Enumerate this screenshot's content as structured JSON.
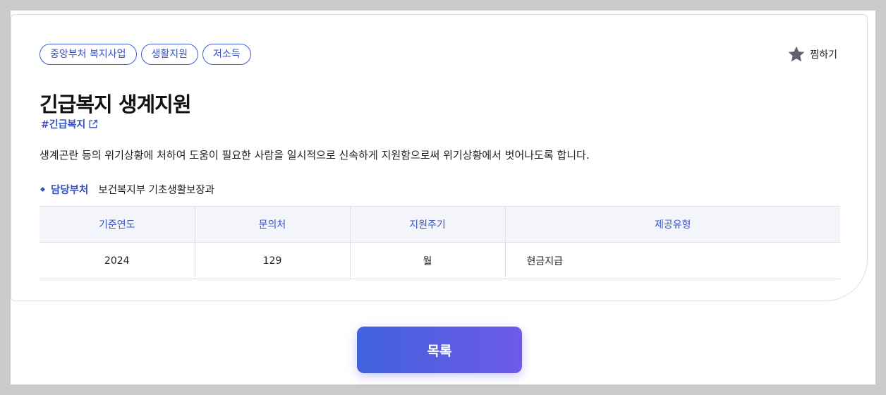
{
  "tags": [
    "중앙부처 복지사업",
    "생활지원",
    "저소득"
  ],
  "favorite": {
    "label": "찜하기",
    "icon": "star-icon"
  },
  "title": "긴급복지 생계지원",
  "hashtag": {
    "label": "#긴급복지",
    "icon": "external-link-icon"
  },
  "description": "생계곤란 등의 위기상황에 처하여 도움이 필요한 사람을 일시적으로 신속하게 지원함으로써 위기상황에서 벗어나도록 합니다.",
  "department": {
    "label": "담당부처",
    "value": "보건복지부 기초생활보장과"
  },
  "table": {
    "headers": [
      "기준연도",
      "문의처",
      "지원주기",
      "제공유형"
    ],
    "row": [
      "2024",
      "129",
      "월",
      "현금지급"
    ]
  },
  "list_button": "목록",
  "colors": {
    "accent": "#3552c8",
    "button_start": "#3f62dc",
    "button_end": "#6e5ae8"
  }
}
